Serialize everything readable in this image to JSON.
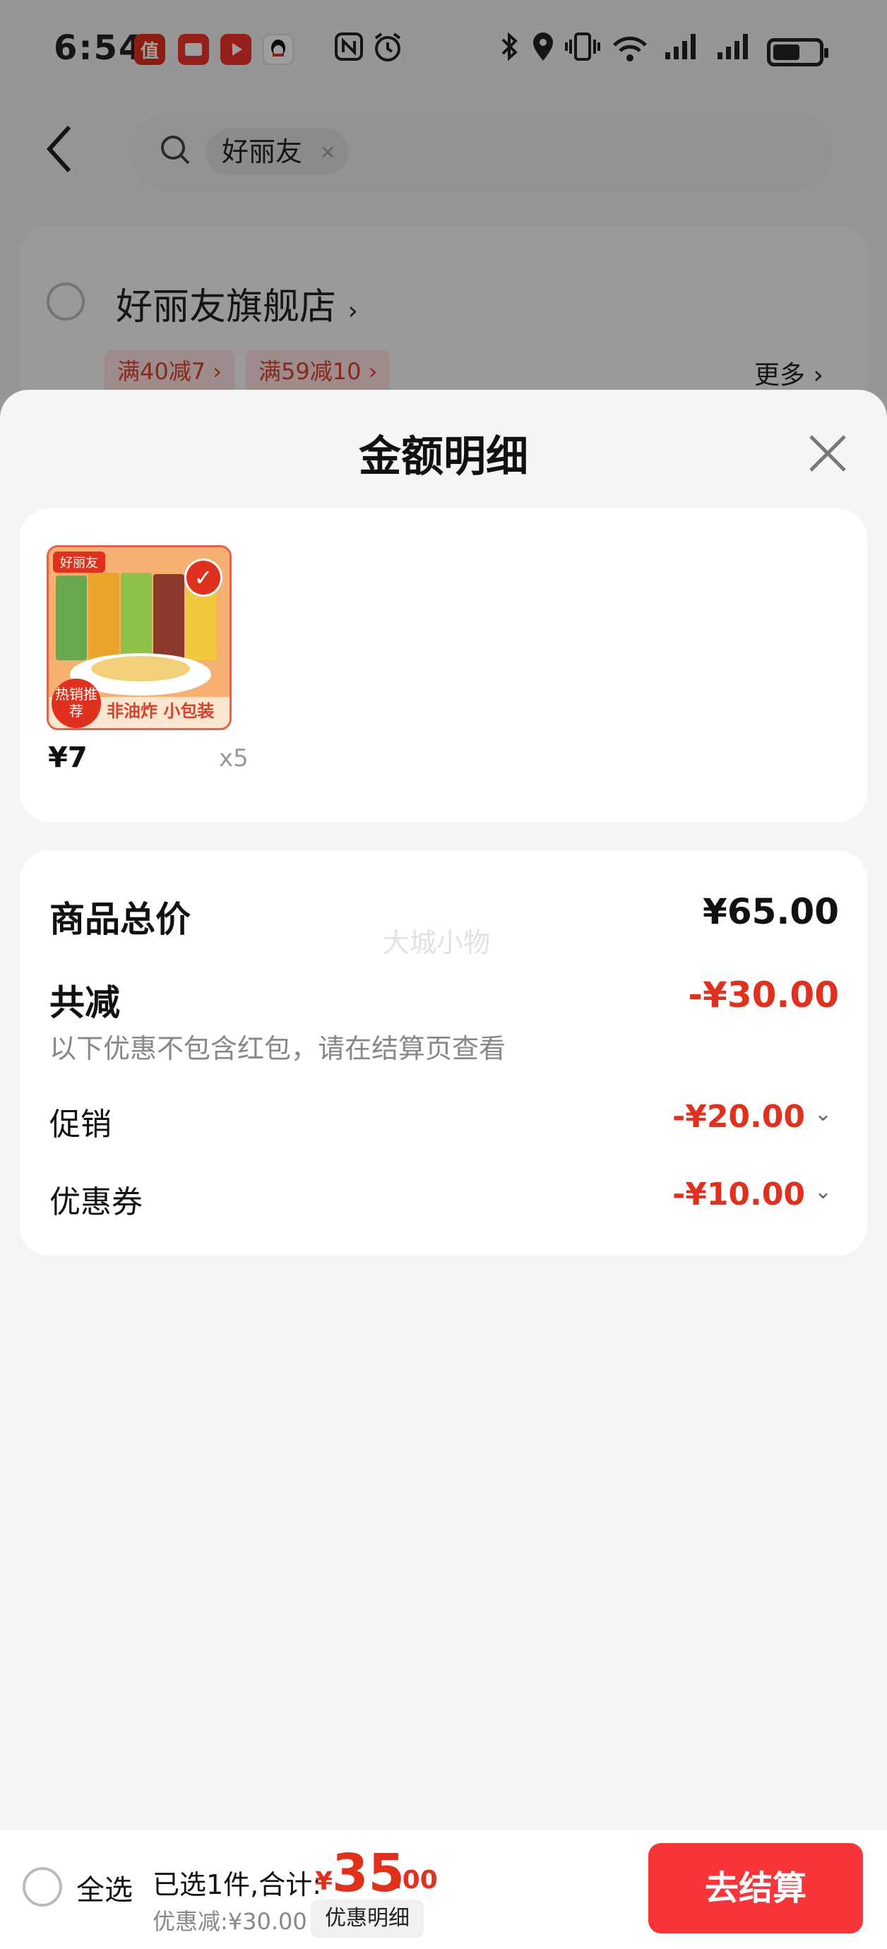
{
  "status_bar": {
    "time": "6:54",
    "app_icons": [
      "值",
      "",
      "",
      ""
    ],
    "icons": [
      "nfc-icon",
      "alarm-icon",
      "bluetooth-icon",
      "location-icon",
      "vibrate-icon",
      "wifi-icon",
      "signal-icon",
      "signal-icon",
      "battery-icon"
    ],
    "battery_level": 0.6
  },
  "header": {
    "search_chip": "好丽友",
    "chip_close": "×"
  },
  "store": {
    "name": "好丽友旗舰店",
    "name_chevron": "›",
    "promos": [
      "满40减7 ›",
      "满59减10 ›"
    ],
    "more": "更多 ›"
  },
  "sheet": {
    "title": "金额明细",
    "product": {
      "brand": "好丽友",
      "badge": "热销推荐",
      "caption": "非油炸 小包装",
      "price": "¥7",
      "quantity": "x5"
    },
    "summary": {
      "watermark": "大城小物",
      "total_label": "商品总价",
      "total_value": "¥65.00",
      "reduce_label": "共减",
      "reduce_value": "-¥30.00",
      "reduce_note": "以下优惠不包含红包，请在结算页查看",
      "promo_label": "促销",
      "promo_value": "-¥20.00",
      "coupon_label": "优惠券",
      "coupon_value": "-¥10.00",
      "chevron": "⌄"
    }
  },
  "bottom_bar": {
    "select_all": "全选",
    "selected_text": "已选1件,合计:",
    "currency": "¥",
    "total_int": "35",
    "total_dec": ".00",
    "discount_text": "优惠减:¥30.00",
    "discount_detail": "优惠明细",
    "checkout": "去结算"
  },
  "colors": {
    "accent_red": "#e0301e",
    "checkout_red": "#f8363a"
  }
}
